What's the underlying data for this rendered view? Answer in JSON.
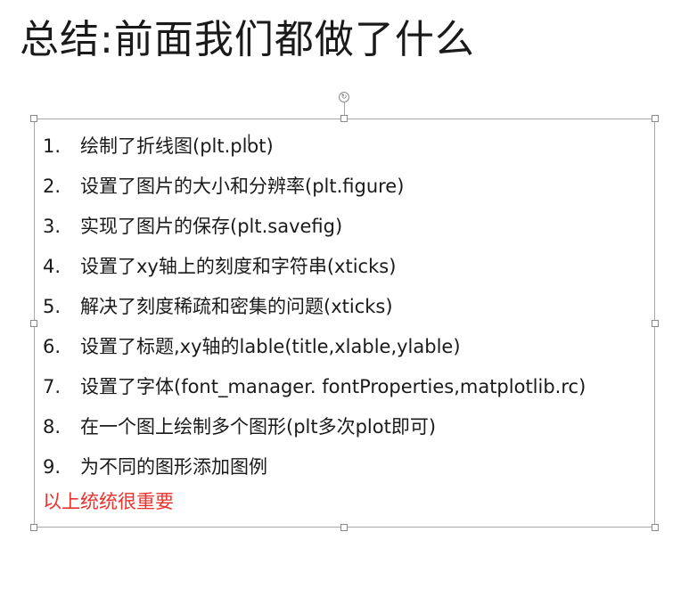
{
  "slide": {
    "title": "总结:前面我们都做了什么",
    "items": [
      {
        "num": "1.",
        "text": "绘制了折线图(plt.plot)"
      },
      {
        "num": "2.",
        "text": "设置了图片的大小和分辨率(plt.figure)"
      },
      {
        "num": "3.",
        "text": "实现了图片的保存(plt.savefig)"
      },
      {
        "num": "4.",
        "text": "设置了xy轴上的刻度和字符串(xticks)"
      },
      {
        "num": "5.",
        "text": "解决了刻度稀疏和密集的问题(xticks)"
      },
      {
        "num": "6.",
        "text": "设置了标题,xy轴的lable(title,xlable,ylable)"
      },
      {
        "num": "7.",
        "text": "设置了字体(font_manager. fontProperties,matplotlib.rc)"
      },
      {
        "num": "8.",
        "text": "在一个图上绘制多个图形(plt多次plot即可)"
      },
      {
        "num": "9.",
        "text": "为不同的图形添加图例"
      }
    ],
    "note": "以上统统很重要"
  },
  "colors": {
    "note": "#e8322c",
    "text": "#1a1a1a",
    "selection_border": "#a8a8a8"
  },
  "icons": {
    "rotate_handle": "rotate-icon",
    "cursor": "text-cursor-icon"
  }
}
